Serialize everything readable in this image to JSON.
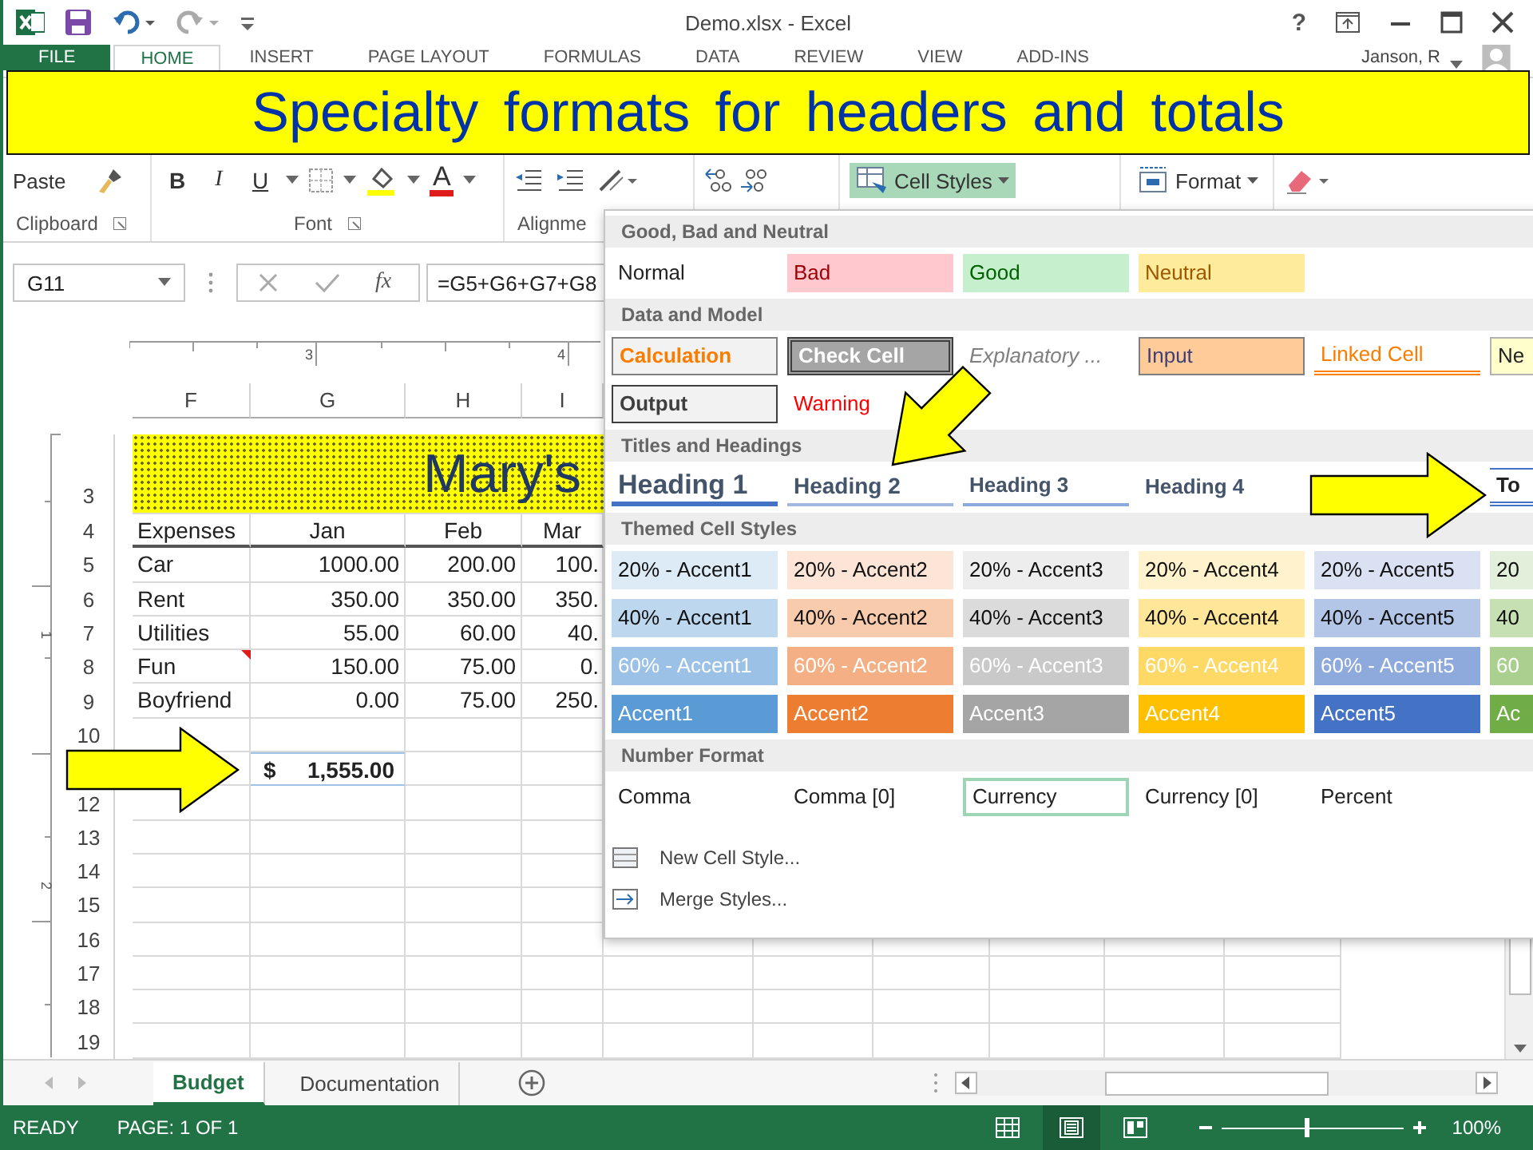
{
  "window": {
    "title": "Demo.xlsx - Excel",
    "help": "?"
  },
  "ribbon_tabs": [
    {
      "label": "FILE",
      "kind": "file",
      "selected": false
    },
    {
      "label": "HOME",
      "kind": "tab",
      "selected": true
    },
    {
      "label": "INSERT",
      "kind": "tab",
      "selected": false
    },
    {
      "label": "PAGE LAYOUT",
      "kind": "tab",
      "selected": false
    },
    {
      "label": "FORMULAS",
      "kind": "tab",
      "selected": false
    },
    {
      "label": "DATA",
      "kind": "tab",
      "selected": false
    },
    {
      "label": "REVIEW",
      "kind": "tab",
      "selected": false
    },
    {
      "label": "VIEW",
      "kind": "tab",
      "selected": false
    },
    {
      "label": "ADD-INS",
      "kind": "tab",
      "selected": false
    }
  ],
  "user": {
    "name": "Janson, R"
  },
  "banner": {
    "text": "Specialty formats for headers and totals"
  },
  "ribbon": {
    "paste": "Paste",
    "clipboard": "Clipboard",
    "bold": "B",
    "italic": "I",
    "underline": "U",
    "font_color": "A",
    "font": "Font",
    "alignment": "Alignme",
    "cell_styles": {
      "label": "Cell Styles",
      "pressed": true
    },
    "format": "Format"
  },
  "formula_bar": {
    "name_box": "G11",
    "fx": "fx",
    "formula": "=G5+G6+G7+G8"
  },
  "sheet": {
    "ruler_marks": [
      "3",
      "4"
    ],
    "side_ruler_marks": [
      "1",
      "2"
    ],
    "columns": [
      "F",
      "G",
      "H",
      "I"
    ],
    "rows": [
      {
        "kind": "title",
        "number": "3",
        "title": "Mary's"
      },
      {
        "kind": "header",
        "number": "4",
        "cells": [
          "Expenses",
          "Jan",
          "Feb",
          "Mar"
        ],
        "comment": false
      },
      {
        "kind": "data",
        "number": "5",
        "cells": [
          "Car",
          "1000.00",
          "200.00",
          "100."
        ],
        "comment": false
      },
      {
        "kind": "data",
        "number": "6",
        "cells": [
          "Rent",
          "350.00",
          "350.00",
          "350."
        ],
        "comment": false
      },
      {
        "kind": "data",
        "number": "7",
        "cells": [
          "Utilities",
          "55.00",
          "60.00",
          "40."
        ],
        "comment": false
      },
      {
        "kind": "data",
        "number": "8",
        "cells": [
          "Fun",
          "150.00",
          "75.00",
          "0."
        ],
        "comment": true
      },
      {
        "kind": "data",
        "number": "9",
        "cells": [
          "Boyfriend",
          "0.00",
          "75.00",
          "250."
        ],
        "comment": false
      },
      {
        "kind": "empty",
        "number": "10"
      },
      {
        "kind": "total",
        "currency": "$",
        "amount": "1,555.00"
      },
      {
        "kind": "empty",
        "number": "12"
      },
      {
        "kind": "empty",
        "number": "13"
      },
      {
        "kind": "empty",
        "number": "14"
      },
      {
        "kind": "empty",
        "number": "15"
      },
      {
        "kind": "empty",
        "number": "16"
      },
      {
        "kind": "empty",
        "number": "17"
      },
      {
        "kind": "empty",
        "number": "18"
      },
      {
        "kind": "empty",
        "number": "19"
      }
    ]
  },
  "cell_styles": {
    "sections": [
      {
        "title": "Good, Bad and Neutral",
        "rows": [
          [
            {
              "label": "Normal",
              "kind": "normal"
            },
            {
              "label": "Bad",
              "kind": "bad"
            },
            {
              "label": "Good",
              "kind": "good"
            },
            {
              "label": "Neutral",
              "kind": "neutral"
            }
          ]
        ]
      },
      {
        "title": "Data and Model",
        "rows": [
          [
            {
              "label": "Calculation",
              "kind": "calculation"
            },
            {
              "label": "Check Cell",
              "kind": "check"
            },
            {
              "label": "Explanatory ...",
              "kind": "explanatory"
            },
            {
              "label": "Input",
              "kind": "input"
            },
            {
              "label": "Linked Cell",
              "kind": "linked"
            },
            {
              "label": "Ne",
              "kind": "note"
            }
          ],
          [
            {
              "label": "Output",
              "kind": "output"
            },
            {
              "label": "Warning",
              "kind": "warning"
            }
          ]
        ]
      },
      {
        "title": "Titles and Headings",
        "rows": [
          [
            {
              "label": "Heading 1",
              "kind": "h1"
            },
            {
              "label": "Heading 2",
              "kind": "h2"
            },
            {
              "label": "Heading 3",
              "kind": "h3"
            },
            {
              "label": "Heading 4",
              "kind": "h4"
            },
            {
              "label": "To",
              "kind": "total"
            }
          ]
        ]
      },
      {
        "title": "Themed Cell Styles",
        "rows": [
          [
            {
              "label": "20% - Accent1",
              "kind": "tint",
              "color": "#ddebf7"
            },
            {
              "label": "20% - Accent2",
              "kind": "tint",
              "color": "#fce4d6"
            },
            {
              "label": "20% - Accent3",
              "kind": "tint",
              "color": "#ededed"
            },
            {
              "label": "20% - Accent4",
              "kind": "tint",
              "color": "#fff2cc"
            },
            {
              "label": "20% - Accent5",
              "kind": "tint",
              "color": "#d9e1f2"
            },
            {
              "label": "20",
              "kind": "tint",
              "color": "#e2efda"
            }
          ],
          [
            {
              "label": "40% - Accent1",
              "kind": "tint",
              "color": "#bdd7ee"
            },
            {
              "label": "40% - Accent2",
              "kind": "tint",
              "color": "#f8cbad"
            },
            {
              "label": "40% - Accent3",
              "kind": "tint",
              "color": "#dbdbdb"
            },
            {
              "label": "40% - Accent4",
              "kind": "tint",
              "color": "#ffe699"
            },
            {
              "label": "40% - Accent5",
              "kind": "tint",
              "color": "#b4c6e7"
            },
            {
              "label": "40",
              "kind": "tint",
              "color": "#c6e0b4"
            }
          ],
          [
            {
              "label": "60% - Accent1",
              "kind": "shade",
              "color": "#9bc2e6"
            },
            {
              "label": "60% - Accent2",
              "kind": "shade",
              "color": "#f4b084"
            },
            {
              "label": "60% - Accent3",
              "kind": "shade",
              "color": "#c9c9c9"
            },
            {
              "label": "60% - Accent4",
              "kind": "shade",
              "color": "#ffd966"
            },
            {
              "label": "60% - Accent5",
              "kind": "shade",
              "color": "#8ea9db"
            },
            {
              "label": "60",
              "kind": "shade",
              "color": "#a9d08e"
            }
          ],
          [
            {
              "label": "Accent1",
              "kind": "solid",
              "color": "#5b9bd5"
            },
            {
              "label": "Accent2",
              "kind": "solid",
              "color": "#ed7d31"
            },
            {
              "label": "Accent3",
              "kind": "solid",
              "color": "#a5a5a5"
            },
            {
              "label": "Accent4",
              "kind": "solid",
              "color": "#ffc000"
            },
            {
              "label": "Accent5",
              "kind": "solid",
              "color": "#4472c4"
            },
            {
              "label": "Ac",
              "kind": "solid",
              "color": "#70ad47"
            }
          ]
        ]
      },
      {
        "title": "Number Format",
        "rows": [
          [
            {
              "label": "Comma",
              "kind": "number",
              "selected": false
            },
            {
              "label": "Comma [0]",
              "kind": "number",
              "selected": false
            },
            {
              "label": "Currency",
              "kind": "number",
              "selected": true
            },
            {
              "label": "Currency [0]",
              "kind": "number",
              "selected": false
            },
            {
              "label": "Percent",
              "kind": "number",
              "selected": false
            }
          ]
        ]
      }
    ],
    "commands": [
      {
        "label": "New Cell Style...",
        "kind": "new"
      },
      {
        "label": "Merge Styles...",
        "kind": "merge"
      }
    ]
  },
  "sheet_tabs": [
    {
      "label": "Budget",
      "selected": true
    },
    {
      "label": "Documentation",
      "selected": false
    }
  ],
  "status_bar": {
    "ready": "READY",
    "page": "PAGE: 1 OF 1",
    "views": [
      {
        "kind": "normal",
        "selected": false
      },
      {
        "kind": "page_layout",
        "selected": true
      },
      {
        "kind": "page_break",
        "selected": false
      }
    ],
    "zoom_slider": {
      "level": 0.45
    },
    "zoom": "100%"
  }
}
